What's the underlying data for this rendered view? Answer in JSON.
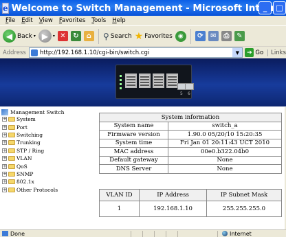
{
  "window": {
    "title": "Welcome to Switch Management - Microsoft Internet Explorer",
    "min_glyph": "_",
    "max_glyph": "□",
    "close_glyph": "✕",
    "logo_glyph": "e"
  },
  "menubar": {
    "items": [
      "File",
      "Edit",
      "View",
      "Favorites",
      "Tools",
      "Help"
    ]
  },
  "toolbar": {
    "back_label": "Back",
    "search_label": "Search",
    "favorites_label": "Favorites",
    "icons": [
      "back-icon",
      "forward-icon",
      "stop-icon",
      "refresh-icon",
      "home-icon",
      "search-icon",
      "favorites-star-icon",
      "media-icon",
      "mail-icon",
      "print-icon",
      "edit-icon"
    ]
  },
  "addressbar": {
    "label": "Address",
    "url": "http://192.168.1.10/cgi-bin/switch.cgi",
    "go_label": "Go",
    "links_label": "Links"
  },
  "banner": {
    "sfp_labels": [
      "5",
      "6"
    ]
  },
  "sidebar": {
    "root_label": "Management Switch",
    "items": [
      {
        "label": "System"
      },
      {
        "label": "Port"
      },
      {
        "label": "Switching"
      },
      {
        "label": "Trunking"
      },
      {
        "label": "STP / Ring"
      },
      {
        "label": "VLAN"
      },
      {
        "label": "QoS"
      },
      {
        "label": "SNMP"
      },
      {
        "label": "802.1x"
      },
      {
        "label": "Other Protocols"
      }
    ]
  },
  "system_info": {
    "title": "System information",
    "rows": [
      {
        "key": "System name",
        "value": "switch_a"
      },
      {
        "key": "Firmware version",
        "value": "1.90.0 05/20/10 15:20:35"
      },
      {
        "key": "System time",
        "value": "Fri Jan 01 20:11:43 UCT 2010"
      },
      {
        "key": "MAC address",
        "value": "00e0.b322.04b0"
      },
      {
        "key": "Default gateway",
        "value": "None"
      },
      {
        "key": "DNS Server",
        "value": "None"
      }
    ]
  },
  "vlan_table": {
    "headers": [
      "VLAN ID",
      "IP Address",
      "IP Subnet Mask"
    ],
    "rows": [
      {
        "id": "1",
        "ip": "192.168.1.10",
        "mask": "255.255.255.0"
      }
    ]
  },
  "statusbar": {
    "left": "Done",
    "zone": "Internet"
  }
}
